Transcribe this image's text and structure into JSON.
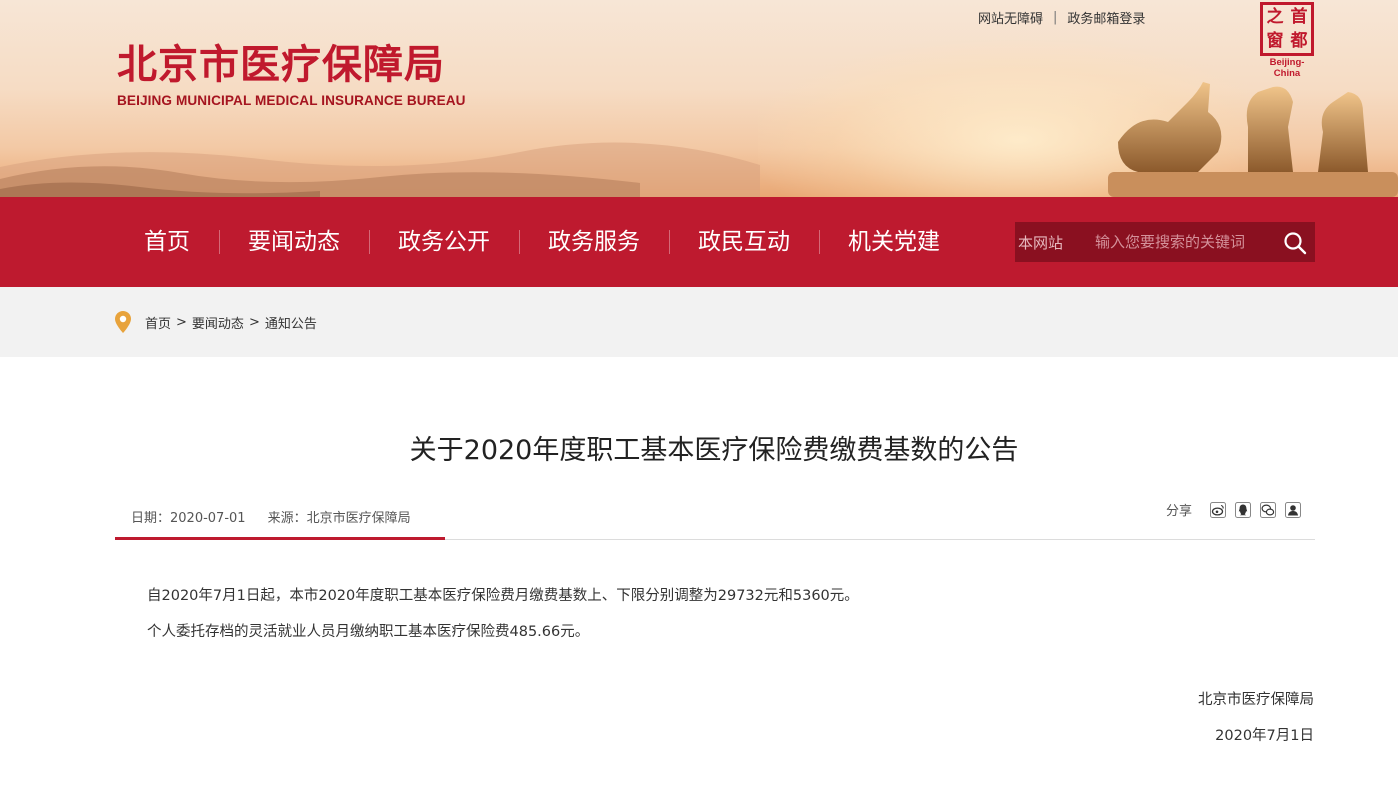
{
  "header": {
    "logo_cn": "北京市医疗保障局",
    "logo_en": "BEIJING MUNICIPAL MEDICAL INSURANCE BUREAU",
    "top_links": [
      "网站无障碍",
      "政务邮箱登录"
    ],
    "top_links_separator": "|",
    "seal_chars": [
      "之",
      "首",
      "窗",
      "都"
    ],
    "seal_caption": "Beijing-China"
  },
  "nav": {
    "items": [
      "首页",
      "要闻动态",
      "政务公开",
      "政务服务",
      "政民互动",
      "机关党建"
    ],
    "search_scope": "本网站",
    "search_placeholder": "输入您要搜索的关键词"
  },
  "breadcrumb": {
    "items": [
      "首页",
      "要闻动态",
      "通知公告"
    ],
    "separator": ">"
  },
  "article": {
    "title": "关于2020年度职工基本医疗保险费缴费基数的公告",
    "date_label": "日期：2020-07-01",
    "source_label": "来源：北京市医疗保障局",
    "share_label": "分享",
    "share_icons": [
      "weibo-icon",
      "qq-icon",
      "wechat-icon",
      "qzone-icon"
    ],
    "paragraphs": [
      "自2020年7月1日起，本市2020年度职工基本医疗保险费月缴费基数上、下限分别调整为29732元和5360元。",
      "个人委托存档的灵活就业人员月缴纳职工基本医疗保险费485.66元。"
    ],
    "signature_org": "北京市医疗保障局",
    "signature_date": "2020年7月1日"
  },
  "colors": {
    "brand_red": "#be1a2f",
    "search_bg": "#8a1020",
    "breadcrumb_bg": "#f2f2f2",
    "pin_orange": "#e8a33c"
  }
}
